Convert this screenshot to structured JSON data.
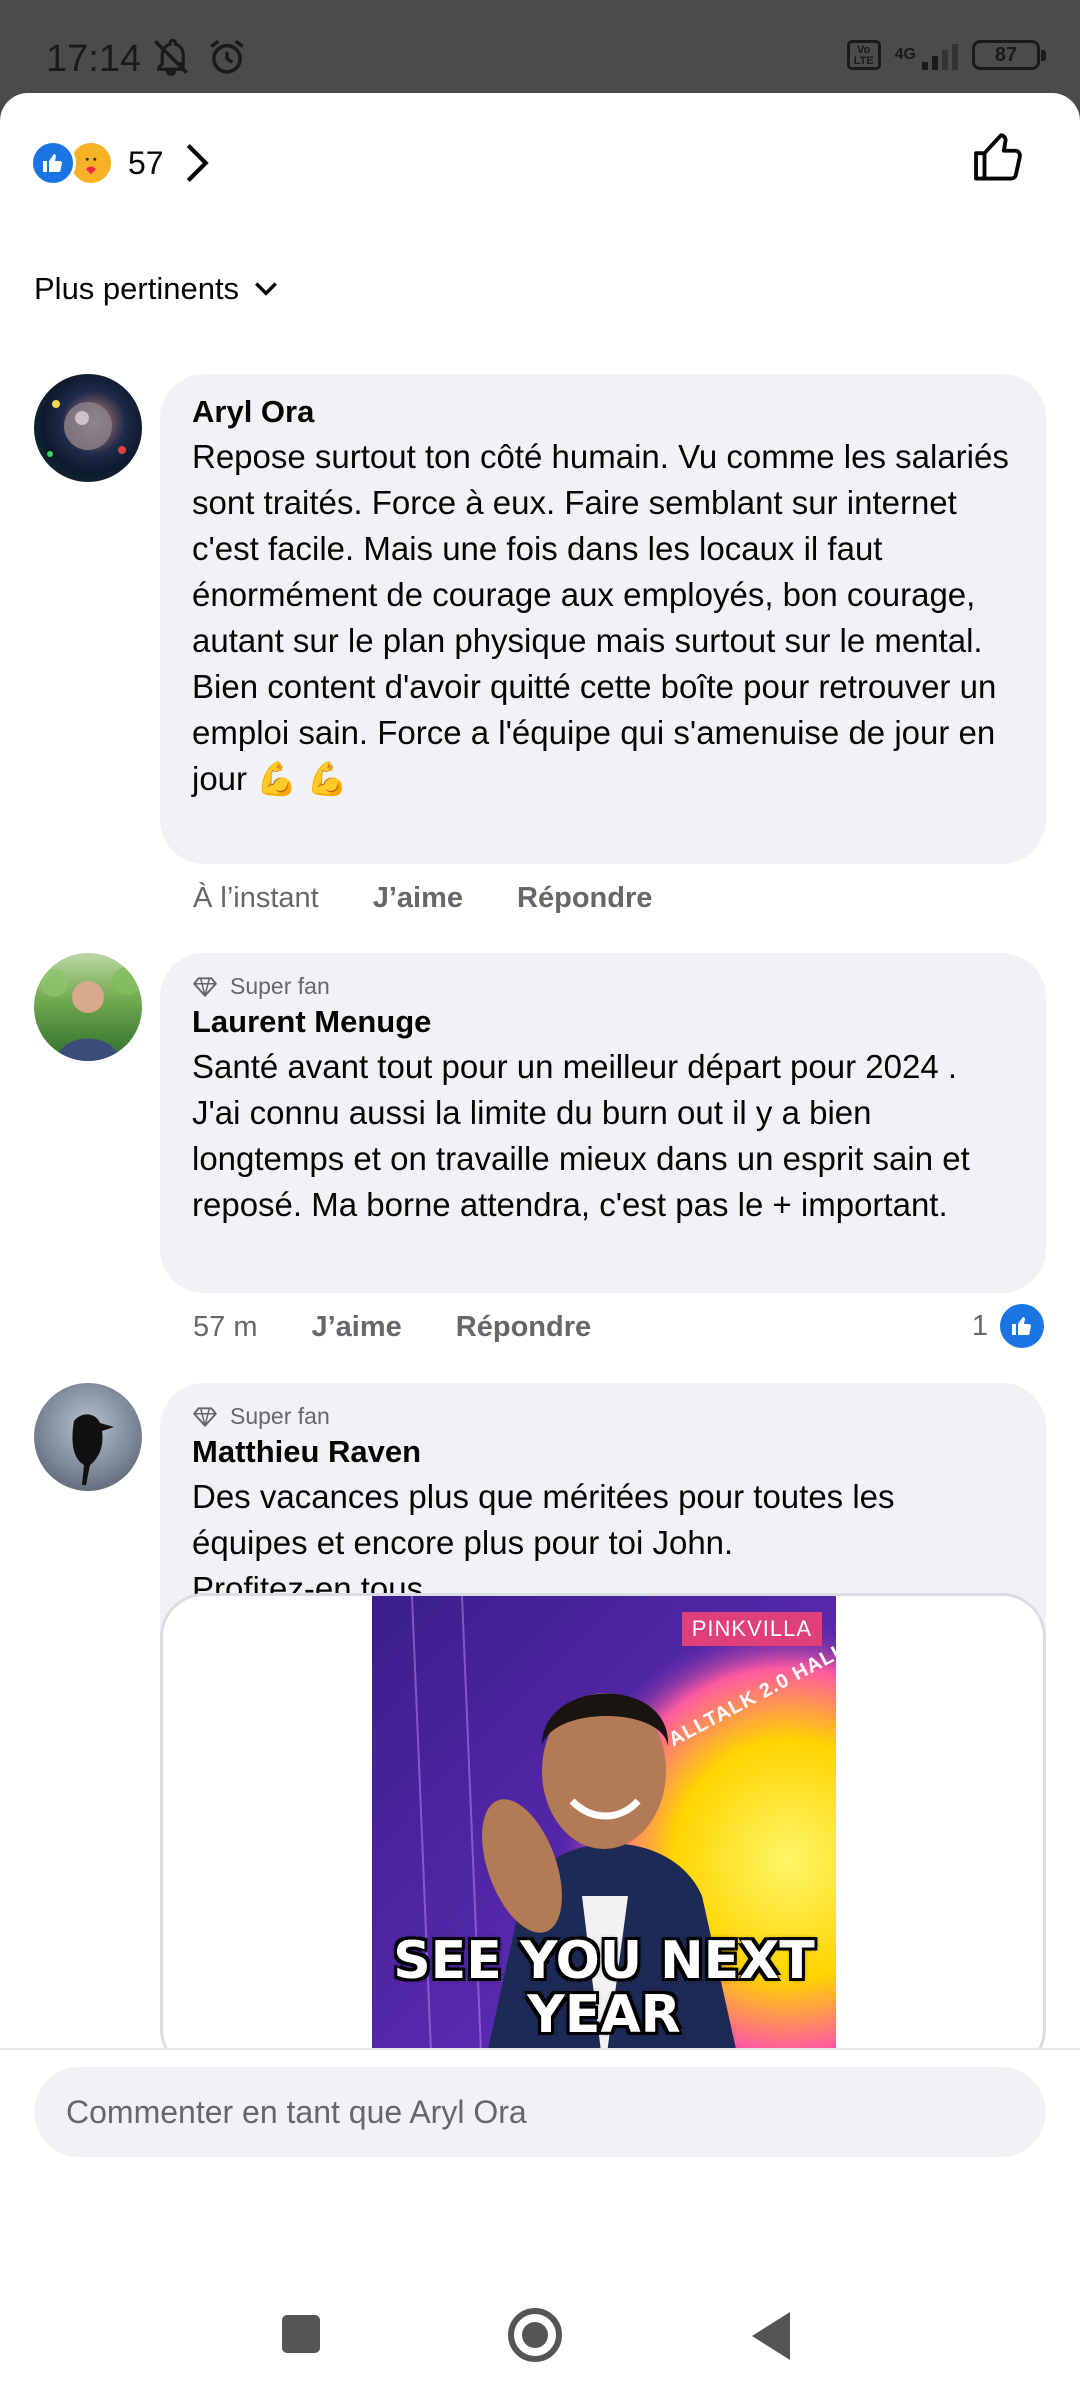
{
  "status_bar": {
    "time": "17:14",
    "network": "4G",
    "volte": "Vo LTE",
    "battery": "87"
  },
  "header": {
    "reaction_count": "57",
    "reaction_icons": [
      "like-icon",
      "care-icon"
    ]
  },
  "sort": {
    "label": "Plus pertinents"
  },
  "comments": [
    {
      "author": "Aryl Ora",
      "badge": "",
      "text": "Repose surtout ton côté humain. Vu comme les salariés sont traités. Force à eux. Faire semblant sur internet c'est facile. Mais une fois dans les locaux il faut énormément de courage aux employés, bon courage, autant sur le plan physique mais surtout sur le mental. Bien content d'avoir quitté cette boîte pour retrouver un emploi sain. Force a l'équipe qui s'amenuise de jour en jour 💪 💪",
      "time": "À l’instant",
      "like_label": "J’aime",
      "reply_label": "Répondre",
      "likes": ""
    },
    {
      "author": "Laurent Menuge",
      "badge": "Super fan",
      "text": "Santé avant tout pour un meilleur départ pour 2024 . J'ai connu aussi la limite du burn out il y a bien longtemps et on travaille mieux dans un esprit sain et reposé. Ma borne attendra, c'est pas le + important.",
      "time": "57 m",
      "like_label": "J’aime",
      "reply_label": "Répondre",
      "likes": "1"
    },
    {
      "author": "Matthieu Raven",
      "badge": "Super fan",
      "text": "Des vacances plus que méritées pour toutes les équipes et encore plus pour toi John.\nProfitez-en tous.\nAu plaisir ✌️",
      "gif_brand": "PINKVILLA",
      "gif_caption": "SEE YOU NEXT YEAR",
      "gif_banner": "ALLTALK 2.0 HALL"
    }
  ],
  "composer": {
    "placeholder": "Commenter en tant que Aryl Ora"
  },
  "colors": {
    "accent": "#1b74e4",
    "bubble": "#f0f2f5",
    "muted_text": "#65676b"
  }
}
